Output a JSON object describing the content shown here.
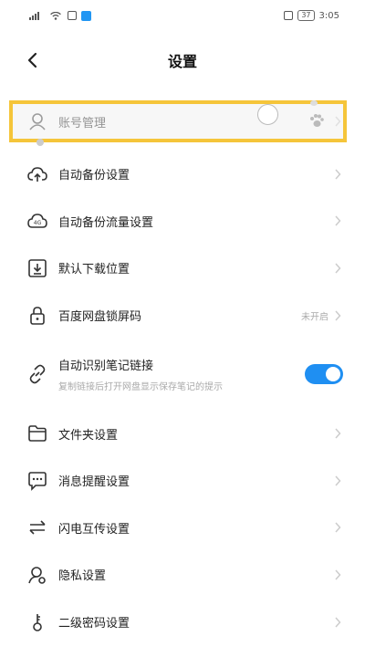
{
  "statusbar": {
    "time": "3:05",
    "battery": "37"
  },
  "header": {
    "title": "设置"
  },
  "items": [
    {
      "label": "账号管理"
    },
    {
      "label": "自动备份设置"
    },
    {
      "label": "自动备份流量设置"
    },
    {
      "label": "默认下载位置"
    },
    {
      "label": "百度网盘锁屏码",
      "state": "未开启"
    },
    {
      "label": "自动识别笔记链接",
      "sub": "复制链接后打开网盘显示保存笔记的提示",
      "toggle_on": true
    },
    {
      "label": "文件夹设置"
    },
    {
      "label": "消息提醒设置"
    },
    {
      "label": "闪电互传设置"
    },
    {
      "label": "隐私设置"
    },
    {
      "label": "二级密码设置"
    }
  ],
  "colors": {
    "accent": "#1f8ff2",
    "highlight": "#f5c53a"
  }
}
